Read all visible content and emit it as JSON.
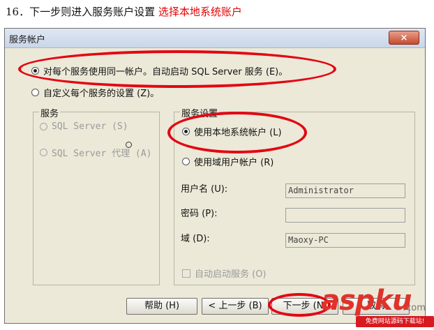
{
  "caption": {
    "prefix": "16．下一步则进入服务账户设置 ",
    "highlight": "选择本地系统账户"
  },
  "dialog": {
    "title": "服务帐户",
    "close_label": "×",
    "options": {
      "same_account": "对每个服务使用同一帐户。自动启动 SQL Server 服务 (E)。",
      "custom": "自定义每个服务的设置 (Z)。"
    },
    "services": {
      "legend": "服务",
      "items": [
        "SQL Server (S)",
        "SQL Server 代理 (A)"
      ]
    },
    "service_settings": {
      "legend": "服务设置",
      "local_system": "使用本地系统帐户 (L)",
      "domain_user": "使用域用户帐户 (R)",
      "username_label": "用户名 (U):",
      "username_value": "Administrator",
      "password_label": "密码 (P):",
      "password_value": "",
      "domain_label": "域 (D):",
      "domain_value": "Maoxy-PC",
      "autostart": "自动启动服务 (O)"
    },
    "buttons": {
      "help": "帮助 (H)",
      "back": "< 上一步 (B)",
      "next": "下一步 (N)",
      "cancel": "取消"
    }
  },
  "watermark": {
    "logo": "aspku",
    "domain": ".com",
    "tagline": "免费网站源码下载站!"
  },
  "colors": {
    "annotation": "#e30613",
    "highlight_text": "#e60000",
    "dialog_bg": "#ece9d8"
  }
}
